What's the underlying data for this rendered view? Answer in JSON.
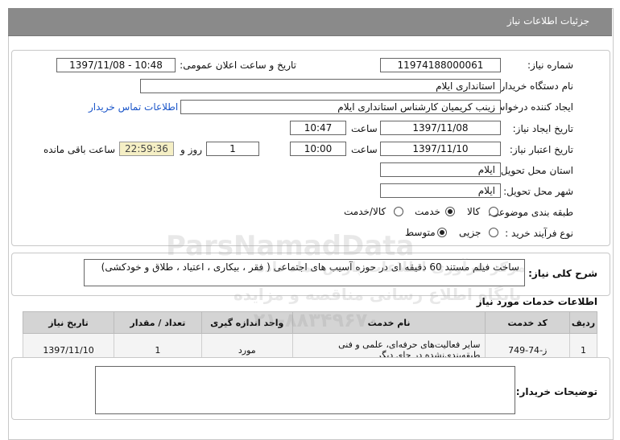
{
  "header": {
    "title": "جزئیات اطلاعات نیاز"
  },
  "form": {
    "need_number": {
      "label": "شماره نیاز:",
      "value": "11974188000061"
    },
    "announce_datetime": {
      "label": "تاریخ و ساعت اعلان عمومی:",
      "value": "1397/11/08 - 10:48"
    },
    "buyer_org": {
      "label": "نام دستگاه خریدار:",
      "value": "استانداری ایلام"
    },
    "requester": {
      "label": "ایجاد کننده درخواست:",
      "value": "زینب کریمیان کارشناس استانداری ایلام",
      "contact_link": "اطلاعات تماس خریدار"
    },
    "created": {
      "label": "تاریخ ایجاد نیاز:",
      "date": "1397/11/08",
      "time_label": "ساعت",
      "time": "10:47"
    },
    "validity": {
      "label": "تاریخ اعتبار نیاز:",
      "date": "1397/11/10",
      "time_label": "ساعت",
      "time": "10:00",
      "days": "1",
      "days_label": "روز و",
      "remaining": "22:59:36",
      "remaining_label": "ساعت باقی مانده"
    },
    "province": {
      "label": "استان محل تحویل:",
      "value": "ایلام"
    },
    "city": {
      "label": "شهر محل تحویل:",
      "value": "ایلام"
    },
    "category": {
      "label": "طبقه بندی موضوعی:",
      "options": [
        {
          "label": "کالا",
          "selected": false
        },
        {
          "label": "خدمت",
          "selected": true
        },
        {
          "label": "کالا/خدمت",
          "selected": false
        }
      ]
    },
    "process_type": {
      "label": "نوع فرآیند خرید :",
      "options": [
        {
          "label": "جزیی",
          "selected": false
        },
        {
          "label": "متوسط",
          "selected": true
        }
      ]
    }
  },
  "description": {
    "label": "شرح کلی نیاز:",
    "value": "ساخت فیلم مستند 60 دقیقه ای در حوزه آسیب های اجتماعی ( فقر ، بیکاری ، اعتیاد ، طلاق و خودکشی)"
  },
  "services": {
    "title": "اطلاعات خدمات مورد نیاز",
    "columns": [
      "ردیف",
      "کد خدمت",
      "نام خدمت",
      "واحد اندازه گیری",
      "تعداد / مقدار",
      "تاریخ نیاز"
    ],
    "rows": [
      {
        "row": "1",
        "code": "ز-74-749",
        "name": "سایر فعالیت‌های حرفه‌ای، علمی و فنی طبقه‌بندی‌نشده در جای دیگر",
        "unit": "مورد",
        "qty": "1",
        "date": "1397/11/10"
      }
    ]
  },
  "buyer_notes": {
    "label": "توضیحات خریدار:",
    "value": ""
  },
  "watermark": {
    "brand": "ParsNamadData",
    "line1": "مرکز فرآوری اطلاعات پارس نماد داده",
    "line2": "پایگاه اطلاع رسانی مناقصه و مزایده",
    "phone": "۰۲۱-۸۸۳۴۹۶۷۰"
  }
}
